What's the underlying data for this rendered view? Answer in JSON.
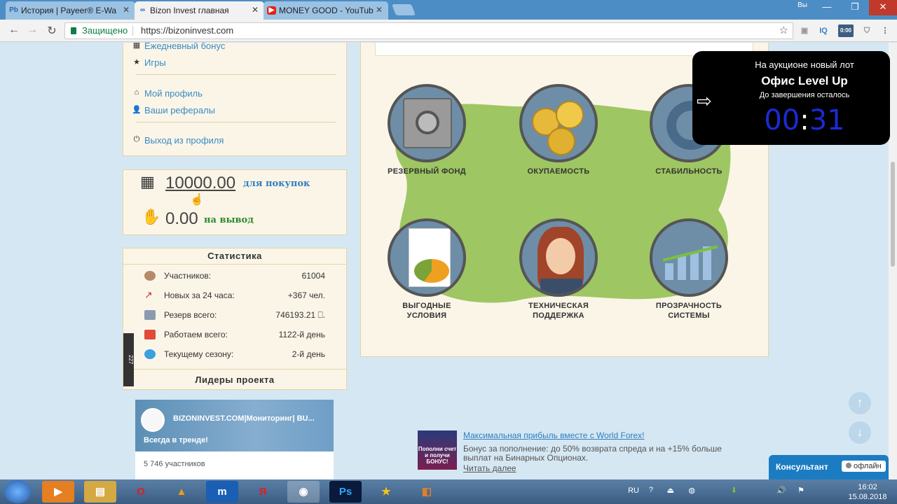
{
  "browser": {
    "tabs": [
      {
        "favicon": "Pb",
        "title": "История | Payeer® E-Wa"
      },
      {
        "favicon": "∞",
        "title": "Bizon Invest главная"
      },
      {
        "favicon": "▶",
        "title": "MONEY GOOD - YouTub"
      }
    ],
    "window_user": "Вы",
    "secure_label": "Защищено",
    "url": "https://bizoninvest.com",
    "ext_iq": "IQ",
    "ext_badge": "0:00"
  },
  "sidebar": {
    "menu": {
      "daily_bonus": "Ежедневный бонус",
      "games": "Игры",
      "profile": "Мой профиль",
      "referrals": "Ваши рефералы",
      "logout": "Выход из профиля"
    },
    "balance": {
      "purchase_amount": "10000.00",
      "purchase_label": "для покупок",
      "withdraw_amount": "0.00",
      "withdraw_label": "на вывод"
    },
    "stats": {
      "title": "Статистика",
      "rows": [
        {
          "label": "Участников:",
          "value": "61004"
        },
        {
          "label": "Новых за 24 часа:",
          "value": "+367 чел."
        },
        {
          "label": "Резерв всего:",
          "value": "746193.21 ⎕."
        },
        {
          "label": "Работаем всего:",
          "value": "1122-й день"
        },
        {
          "label": "Текущему сезону:",
          "value": "2-й день"
        }
      ],
      "leaders": "Лидеры проекта"
    },
    "side_counter": "227"
  },
  "widget": {
    "title": "BIZONINVEST.COM|Мониторинг| BU...",
    "subtitle": "Всегда в тренде!",
    "members": "5 746 участников"
  },
  "features": [
    {
      "label": "РЕЗЕРВНЫЙ ФОНД",
      "icon": "safe-icon"
    },
    {
      "label": "ОКУПАЕМОСТЬ",
      "icon": "coins-icon"
    },
    {
      "label": "СТАБИЛЬНОСТЬ",
      "icon": "stability-icon"
    },
    {
      "label": "ВЫГОДНЫЕ\nУСЛОВИЯ",
      "icon": "document-chart-icon"
    },
    {
      "label": "ТЕХНИЧЕСКАЯ\nПОДДЕРЖКА",
      "icon": "support-operator-icon"
    },
    {
      "label": "ПРОЗРАЧНОСТЬ\nСИСТЕМЫ",
      "icon": "growth-chart-icon"
    }
  ],
  "auction_popup": {
    "line1": "На аукционе новый лот",
    "lot": "Офис Level Up",
    "line3": "До завершения осталось",
    "timer_min": "00",
    "timer_sec": "31"
  },
  "forex_ad": {
    "image_text": "Пополни счет и получи БОНУС!",
    "title": "Максимальная прибыль вместе с World Forex!",
    "text": "Бонус за пополнение: до 50% возврата спреда и на +15% больше выплат на Бинарных Опционах.",
    "more": "Читать далее"
  },
  "consultant": {
    "label": "Консультант",
    "status": "офлайн"
  },
  "taskbar": {
    "lang": "RU",
    "time": "16:02",
    "date": "15.08.2018"
  },
  "colors": {
    "link": "#3a8ac2",
    "panel_bg": "#fbf5e8",
    "panel_border": "#e6d3a6",
    "accent_blue": "#1b7cc2",
    "timer": "#1a2bd6",
    "green_amount": "#2d8a2d"
  }
}
